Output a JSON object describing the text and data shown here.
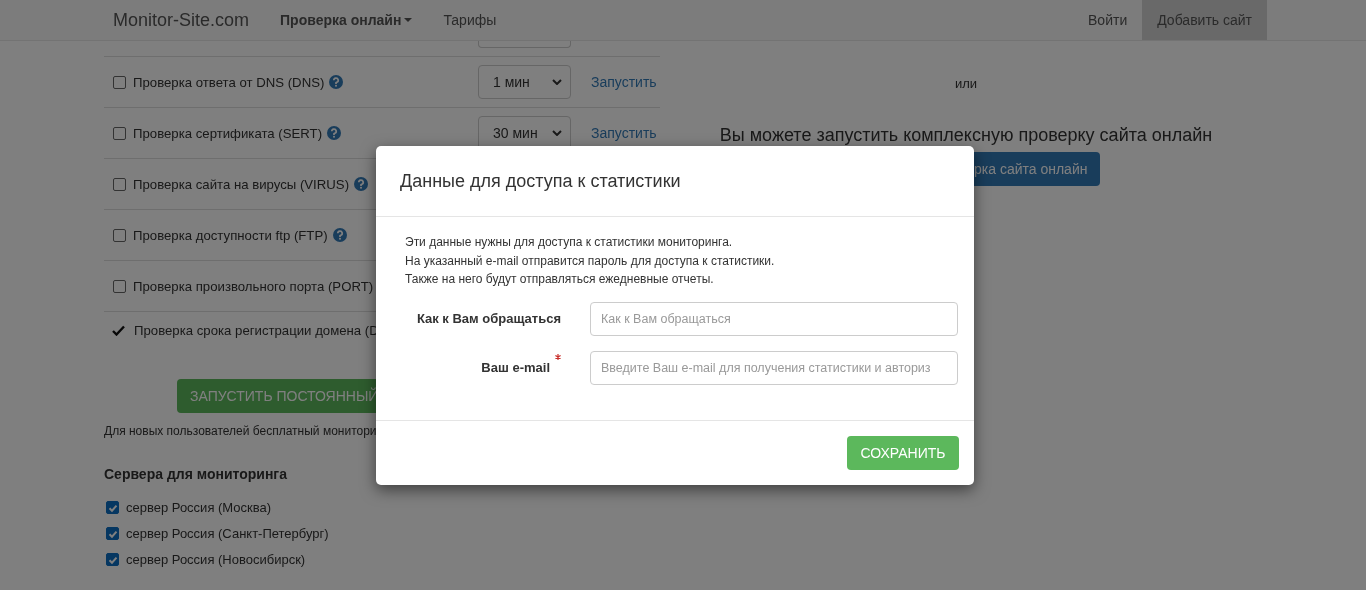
{
  "navbar": {
    "brand": "Monitor-Site.com",
    "items": [
      {
        "label": "Проверка онлайн",
        "dropdown": true
      },
      {
        "label": "Тарифы"
      }
    ],
    "right_items": [
      {
        "label": "Войти",
        "selected": false
      },
      {
        "label": "Добавить сайт",
        "selected": true
      }
    ]
  },
  "checks": [
    {
      "kind": "cut"
    },
    {
      "kind": "checkbox",
      "label": "Проверка ответа от DNS (DNS)",
      "checked": false,
      "help": true,
      "interval": "1 мин",
      "action": "Запустить"
    },
    {
      "kind": "checkbox",
      "label": "Проверка сертификата (SERT)",
      "checked": false,
      "help": true,
      "interval": "30 мин",
      "action": "Запустить"
    },
    {
      "kind": "checkbox",
      "label": "Проверка сайта на вирусы (VIRUS)",
      "checked": false,
      "help": true
    },
    {
      "kind": "checkbox",
      "label": "Проверка доступности ftp (FTP)",
      "checked": false,
      "help": true
    },
    {
      "kind": "checkbox",
      "label": "Проверка произвольного порта (PORT)",
      "checked": false
    },
    {
      "kind": "done",
      "label": "Проверка срока регистрации домена (D"
    }
  ],
  "start_button": "ЗАПУСТИТЬ ПОСТОЯННЫЙ",
  "note": "Для новых пользователей бесплатный монитори",
  "servers": {
    "title": "Сервера для мониторинга",
    "items": [
      {
        "label": "сервер Россия (Москва)",
        "checked": true
      },
      {
        "label": "сервер Россия (Санкт-Петербург)",
        "checked": true
      },
      {
        "label": "сервер Россия (Новосибирск)",
        "checked": true
      }
    ]
  },
  "right": {
    "or": "или",
    "heading": "Вы можете запустить комплексную проверку сайта онлайн",
    "button": "рка сайта онлайн"
  },
  "modal": {
    "title": "Данные для доступа к статистики",
    "lines": [
      "Эти данные нужны для доступа к статистики мониторинга.",
      "На указанный e-mail отправится пароль для доступа к статистики.",
      "Также на него будут отправляться ежедневные отчеты."
    ],
    "fields": [
      {
        "label": "Как к Вам обращаться",
        "placeholder": "Как к Вам обращаться"
      },
      {
        "label": "Ваш e-mail",
        "placeholder": "Введите Ваш e-mail для получения статистики и авториз",
        "required": true
      }
    ],
    "button": "СОХРАНИТЬ"
  }
}
